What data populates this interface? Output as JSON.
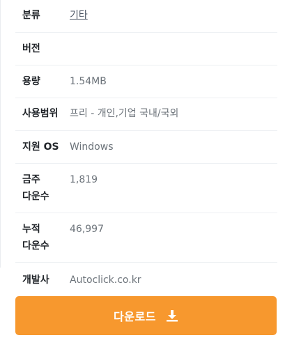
{
  "details": {
    "category": {
      "label": "분류",
      "value": "기타"
    },
    "version": {
      "label": "버전",
      "value": ""
    },
    "size": {
      "label": "용량",
      "value": "1.54MB"
    },
    "license": {
      "label": "사용범위",
      "value": "프리 - 개인,기업 국내/국외"
    },
    "os": {
      "label": "지원 OS",
      "value": "Windows"
    },
    "weekly_downloads": {
      "label": "금주 다운수",
      "value": "1,819"
    },
    "total_downloads": {
      "label": "누적 다운수",
      "value": "46,997"
    },
    "developer": {
      "label": "개발사",
      "value": "Autoclick.co.kr"
    }
  },
  "download_button": {
    "label": "다운로드",
    "icon": "download-icon"
  },
  "colors": {
    "accent": "#f7982e"
  }
}
